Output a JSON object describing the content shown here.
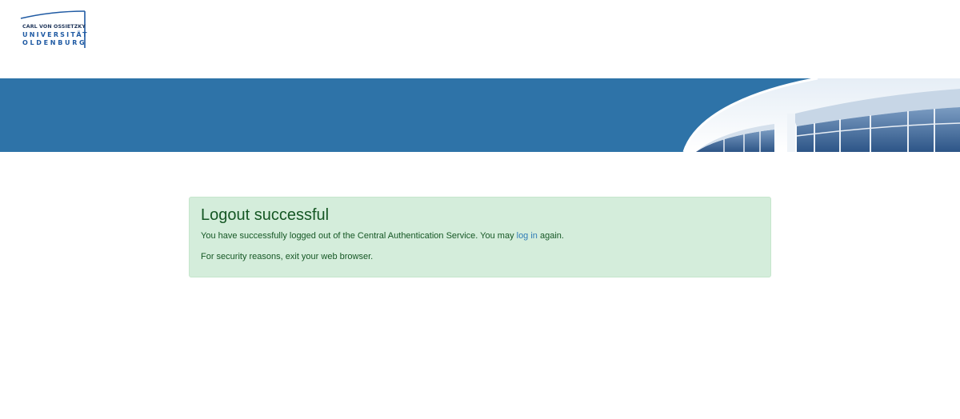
{
  "header": {
    "logo": {
      "line1": "CARL VON OSSIETZKY",
      "line2": "UNIVERSITÄT",
      "line3": "OLDENBURG"
    }
  },
  "banner": {
    "color": "#2e73a8"
  },
  "alert": {
    "title": "Logout successful",
    "message_prefix": "You have successfully logged out of the Central Authentication Service. You may ",
    "link_label": "log in",
    "message_suffix": " again.",
    "security_note": "For security reasons, exit your web browser.",
    "background": "#d4eddb",
    "text_color": "#155724",
    "link_color": "#2f7cb7"
  }
}
